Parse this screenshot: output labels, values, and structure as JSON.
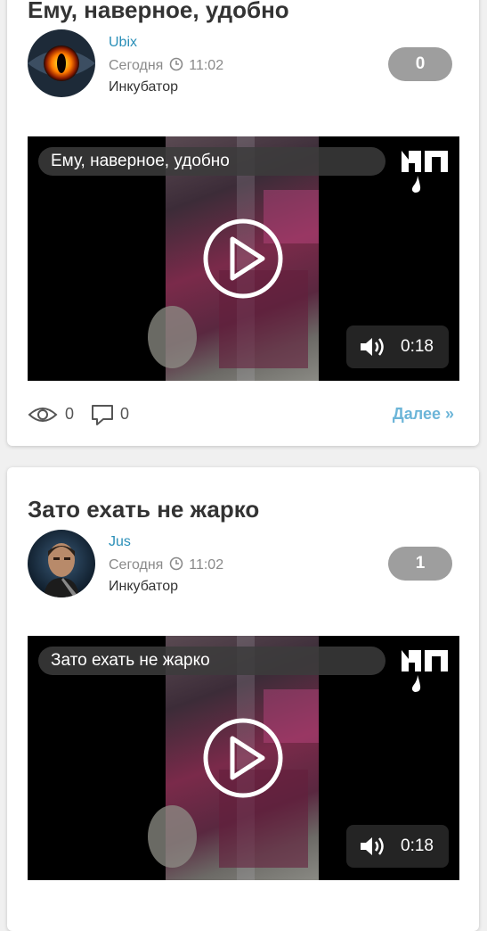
{
  "posts": [
    {
      "title": "Ему, наверное, удобно",
      "author": "Ubix",
      "date": "Сегодня",
      "time": "11:02",
      "category": "Инкубатор",
      "rating": "0",
      "video": {
        "title": "Ему, наверное, удобно",
        "duration": "0:18"
      },
      "views": "0",
      "comments": "0",
      "more_label": "Далее »"
    },
    {
      "title": "Зато ехать не жарко",
      "author": "Jus",
      "date": "Сегодня",
      "time": "11:02",
      "category": "Инкубатор",
      "rating": "1",
      "video": {
        "title": "Зато ехать не жарко",
        "duration": "0:18"
      }
    }
  ],
  "icons": {
    "clock": "clock-icon",
    "play": "play-icon",
    "volume": "volume-icon",
    "eye": "eye-icon",
    "comment": "comment-icon",
    "logo": "yap-logo"
  },
  "colors": {
    "author_link": "#2a8fb8",
    "more_link": "#6cb5d8",
    "rating_badge": "#9e9e9e"
  }
}
